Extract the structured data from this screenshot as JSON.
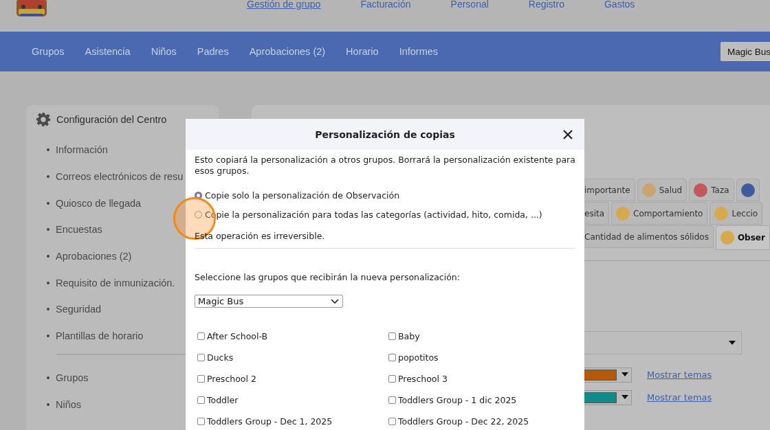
{
  "header_links": [
    {
      "label": "Gestión de grupo",
      "selected": true
    },
    {
      "label": "Facturación",
      "selected": false
    },
    {
      "label": "Personal",
      "selected": false
    },
    {
      "label": "Registro",
      "selected": false
    },
    {
      "label": "Gastos",
      "selected": false
    }
  ],
  "nav": {
    "items": [
      "Grupos",
      "Asistencia",
      "Niños",
      "Padres",
      "Aprobaciones (2)",
      "Horario",
      "Informes"
    ],
    "account_button": "Magic Bus"
  },
  "sidebar": {
    "title": "Configuración del Centro",
    "items": [
      "Información",
      "Correos electrónicos de resu",
      "Quiosco de llegada",
      "Encuestas",
      "Aprobaciones (2)",
      "Requisito de inmunización.",
      "Seguridad",
      "Plantillas de horario"
    ],
    "items_2": [
      "Grupos",
      "Niños"
    ]
  },
  "category_tabs": [
    [
      {
        "label": "importante",
        "selected": false
      },
      {
        "label": "Salud",
        "color": "#c9a46e",
        "selected": false
      },
      {
        "label": "Taza",
        "color": "#c4585e",
        "selected": false
      },
      {
        "color": "#3e5c9c",
        "selected": false
      }
    ],
    [
      {
        "label": "esita",
        "selected": false
      },
      {
        "label": "Comportamiento",
        "color": "#d6a94e",
        "selected": false
      },
      {
        "label": "Leccio",
        "color": "#d6a94e",
        "selected": false
      }
    ],
    [
      {
        "label": "Cantidad de alimentos sólidos",
        "selected": false
      },
      {
        "label": "Obser",
        "color": "#d6a94e",
        "selected": true
      }
    ]
  ],
  "theme_rows": [
    {
      "color": "#b45a0a",
      "link": "Mostrar temas"
    },
    {
      "color": "#118a8a",
      "link": "Mostrar temas"
    }
  ],
  "modal": {
    "title": "Personalización de copias",
    "description": "Esto copiará la personalización a otros grupos. Borrará la personalización existente para esos grupos.",
    "options": [
      {
        "label": "Copie solo la personalización de Observación",
        "selected": true
      },
      {
        "label": "Copie la personalización para todas las categorías (actividad, hito, comida, ...)",
        "selected": false
      }
    ],
    "warning": "Esta operación es irreversible.",
    "instruction": "Seleccione las grupos que recibirán la nueva personalización:",
    "center_select": "Magic Bus",
    "groups": [
      {
        "label": "After School-B",
        "checked": false
      },
      {
        "label": "Baby",
        "checked": false
      },
      {
        "label": "Ducks",
        "checked": false
      },
      {
        "label": "popotitos",
        "checked": false
      },
      {
        "label": "Preschool 2",
        "checked": false
      },
      {
        "label": "Preschool 3",
        "checked": false
      },
      {
        "label": "Toddler",
        "checked": false
      },
      {
        "label": "Toddlers Group - 1 dic 2025",
        "checked": false
      },
      {
        "label": "Toddlers Group - Dec 1, 2025",
        "checked": false
      },
      {
        "label": "Toddlers Group - Dec 22, 2025",
        "checked": false
      }
    ]
  },
  "click_highlight": {
    "on": true
  }
}
